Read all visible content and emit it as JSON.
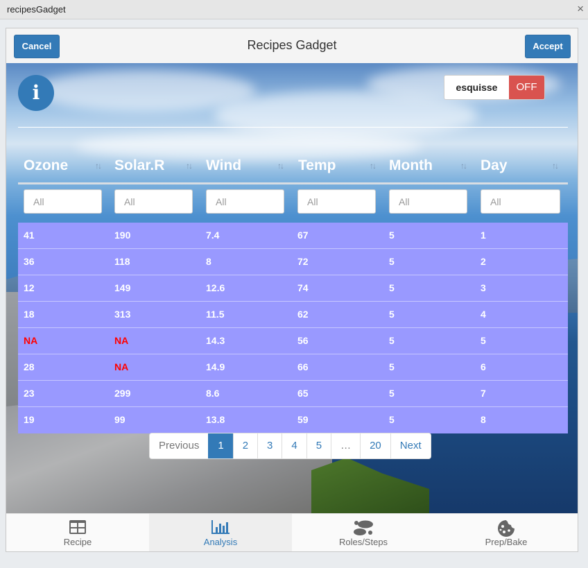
{
  "window": {
    "title": "recipesGadget",
    "close_glyph": "×"
  },
  "dialog": {
    "title": "Recipes Gadget",
    "cancel_label": "Cancel",
    "accept_label": "Accept"
  },
  "info_icon_glyph": "i",
  "toggle": {
    "label": "esquisse",
    "state": "OFF"
  },
  "table": {
    "columns": [
      "Ozone",
      "Solar.R",
      "Wind",
      "Temp",
      "Month",
      "Day"
    ],
    "sort_glyph": "↑↓",
    "filter_placeholder": "All",
    "rows": [
      [
        "41",
        "190",
        "7.4",
        "67",
        "5",
        "1"
      ],
      [
        "36",
        "118",
        "8",
        "72",
        "5",
        "2"
      ],
      [
        "12",
        "149",
        "12.6",
        "74",
        "5",
        "3"
      ],
      [
        "18",
        "313",
        "11.5",
        "62",
        "5",
        "4"
      ],
      [
        "NA",
        "NA",
        "14.3",
        "56",
        "5",
        "5"
      ],
      [
        "28",
        "NA",
        "14.9",
        "66",
        "5",
        "6"
      ],
      [
        "23",
        "299",
        "8.6",
        "65",
        "5",
        "7"
      ],
      [
        "19",
        "99",
        "13.8",
        "59",
        "5",
        "8"
      ]
    ],
    "na_color": "#ff0000",
    "row_bg": "#9999ff"
  },
  "pagination": {
    "previous": "Previous",
    "pages": [
      "1",
      "2",
      "3",
      "4",
      "5"
    ],
    "ellipsis": "…",
    "last": "20",
    "next": "Next",
    "active_page": "1"
  },
  "tabs": [
    {
      "label": "Recipe",
      "icon": "table-icon",
      "active": false
    },
    {
      "label": "Analysis",
      "icon": "bar-chart-icon",
      "active": true
    },
    {
      "label": "Roles/Steps",
      "icon": "footsteps-icon",
      "active": false
    },
    {
      "label": "Prep/Bake",
      "icon": "cookie-icon",
      "active": false
    }
  ],
  "colors": {
    "primary": "#337ab7",
    "danger": "#d9534f"
  }
}
